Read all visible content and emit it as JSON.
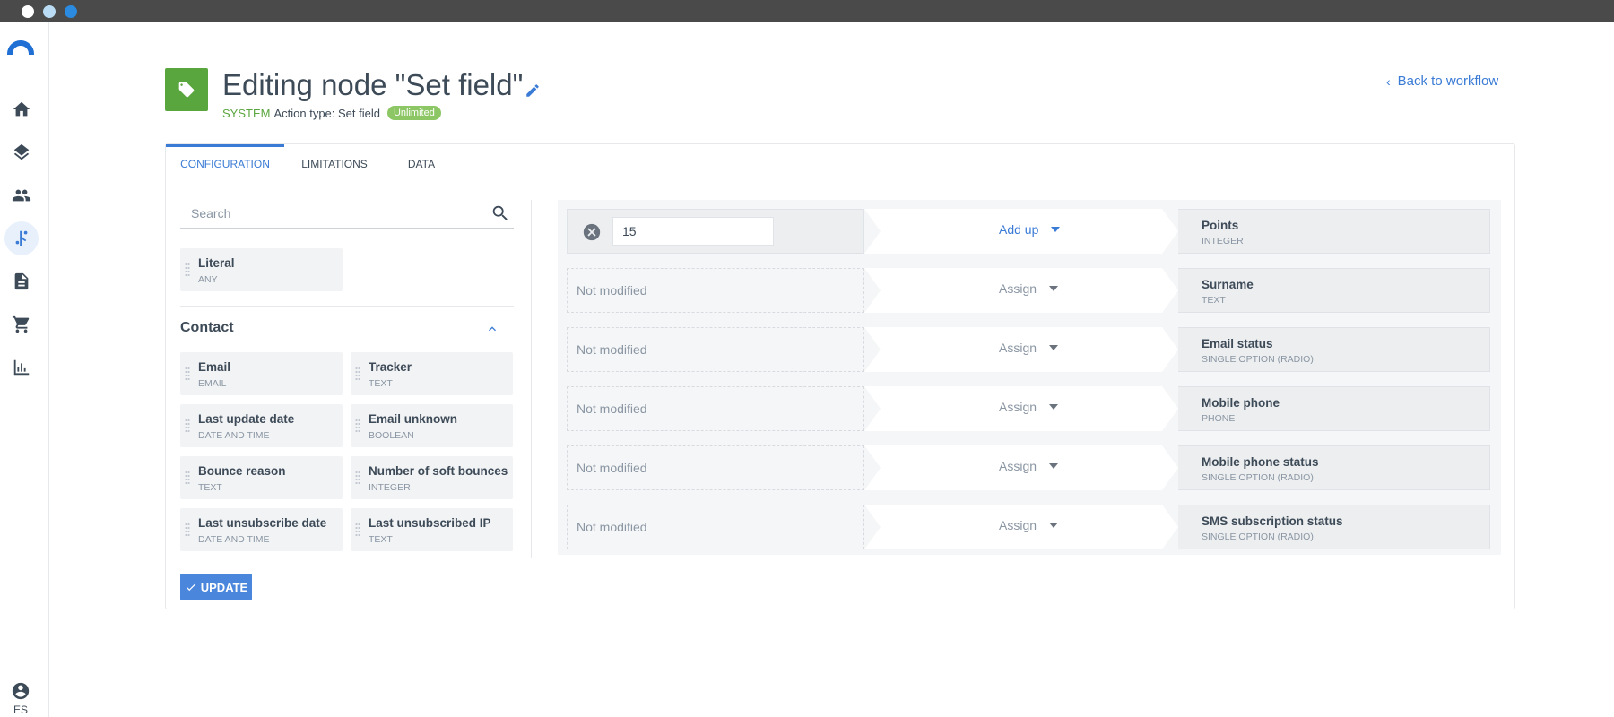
{
  "window": {
    "dots": [
      "close",
      "minimize",
      "maximize"
    ]
  },
  "sidebar": {
    "items": [
      {
        "icon": "home-icon",
        "active": false
      },
      {
        "icon": "layers-icon",
        "active": false
      },
      {
        "icon": "people-icon",
        "active": false
      },
      {
        "icon": "workflow-icon",
        "active": true
      },
      {
        "icon": "document-icon",
        "active": false
      },
      {
        "icon": "cart-icon",
        "active": false
      },
      {
        "icon": "chart-icon",
        "active": false
      }
    ],
    "user_label": "ES"
  },
  "header": {
    "title": "Editing node \"Set field\"",
    "system_label": "SYSTEM",
    "action_type": "Action type: Set field",
    "badge": "Unlimited",
    "back_link": "Back to workflow"
  },
  "tabs": [
    "CONFIGURATION",
    "LIMITATIONS",
    "DATA"
  ],
  "active_tab": "CONFIGURATION",
  "left_panel": {
    "search_placeholder": "Search",
    "literal": {
      "name": "Literal",
      "type": "ANY"
    },
    "group_title": "Contact",
    "fields": [
      {
        "name": "Email",
        "type": "EMAIL"
      },
      {
        "name": "Tracker",
        "type": "TEXT"
      },
      {
        "name": "Last update date",
        "type": "DATE AND TIME"
      },
      {
        "name": "Email unknown",
        "type": "BOOLEAN"
      },
      {
        "name": "Bounce reason",
        "type": "TEXT"
      },
      {
        "name": "Number of soft bounces",
        "type": "INTEGER"
      },
      {
        "name": "Last unsubscribe date",
        "type": "DATE AND TIME"
      },
      {
        "name": "Last unsubscribed IP",
        "type": "TEXT"
      }
    ]
  },
  "mappings": [
    {
      "value": "15",
      "operation": "Add up",
      "target": "Points",
      "target_type": "INTEGER",
      "active": true
    },
    {
      "value": "Not modified",
      "operation": "Assign",
      "target": "Surname",
      "target_type": "TEXT",
      "active": false
    },
    {
      "value": "Not modified",
      "operation": "Assign",
      "target": "Email status",
      "target_type": "SINGLE OPTION (RADIO)",
      "active": false
    },
    {
      "value": "Not modified",
      "operation": "Assign",
      "target": "Mobile phone",
      "target_type": "PHONE",
      "active": false
    },
    {
      "value": "Not modified",
      "operation": "Assign",
      "target": "Mobile phone status",
      "target_type": "SINGLE OPTION (RADIO)",
      "active": false
    },
    {
      "value": "Not modified",
      "operation": "Assign",
      "target": "SMS subscription status",
      "target_type": "SINGLE OPTION (RADIO)",
      "active": false
    }
  ],
  "footer": {
    "update_label": "UPDATE"
  },
  "colors": {
    "accent": "#3a7bd5",
    "node_green": "#5aa63e",
    "badge_green": "#8cc665"
  }
}
